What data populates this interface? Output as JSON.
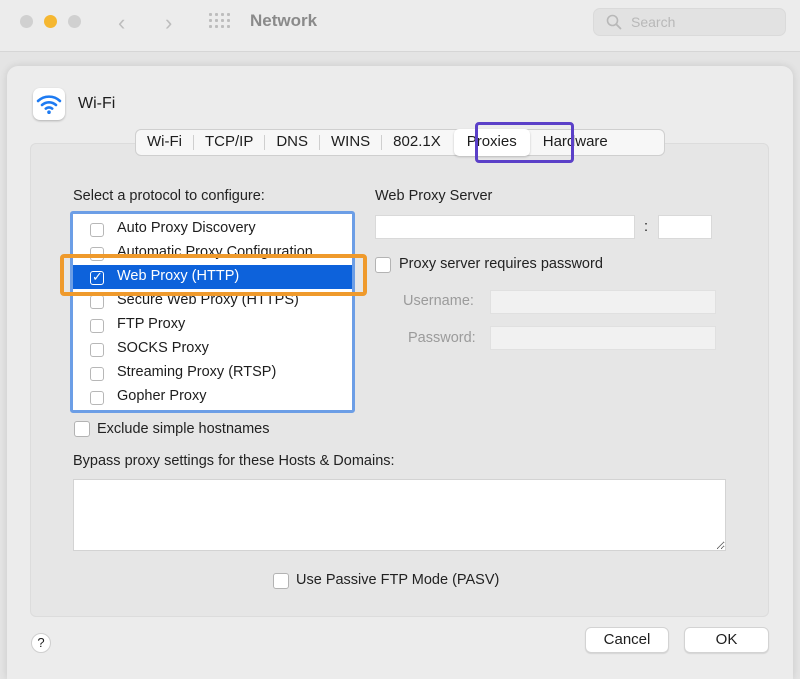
{
  "window": {
    "title": "Network",
    "search_placeholder": "Search",
    "colors": {
      "close": "#d0d0d0",
      "minimize": "#f5b731",
      "zoom": "#d0d0d0"
    }
  },
  "interface": {
    "name": "Wi-Fi",
    "icon": "wifi-icon"
  },
  "tabs": [
    {
      "label": "Wi-Fi",
      "active": false
    },
    {
      "label": "TCP/IP",
      "active": false
    },
    {
      "label": "DNS",
      "active": false
    },
    {
      "label": "WINS",
      "active": false
    },
    {
      "label": "802.1X",
      "active": false
    },
    {
      "label": "Proxies",
      "active": true
    },
    {
      "label": "Hardware",
      "active": false
    }
  ],
  "protocols": {
    "heading": "Select a protocol to configure:",
    "items": [
      {
        "label": "Auto Proxy Discovery",
        "checked": false,
        "selected": false
      },
      {
        "label": "Automatic Proxy Configuration",
        "checked": false,
        "selected": false
      },
      {
        "label": "Web Proxy (HTTP)",
        "checked": true,
        "selected": true
      },
      {
        "label": "Secure Web Proxy (HTTPS)",
        "checked": false,
        "selected": false
      },
      {
        "label": "FTP Proxy",
        "checked": false,
        "selected": false
      },
      {
        "label": "SOCKS Proxy",
        "checked": false,
        "selected": false
      },
      {
        "label": "Streaming Proxy (RTSP)",
        "checked": false,
        "selected": false
      },
      {
        "label": "Gopher Proxy",
        "checked": false,
        "selected": false
      }
    ]
  },
  "proxy_server": {
    "heading": "Web Proxy Server",
    "host_value": "",
    "separator": ":",
    "port_value": "",
    "requires_password_label": "Proxy server requires password",
    "requires_password": false,
    "username_label": "Username:",
    "username_value": "",
    "password_label": "Password:",
    "password_value": ""
  },
  "exclude_simple_hostnames": {
    "label": "Exclude simple hostnames",
    "checked": false
  },
  "bypass": {
    "label": "Bypass proxy settings for these Hosts & Domains:",
    "value": ""
  },
  "passive_ftp": {
    "label": "Use Passive FTP Mode (PASV)",
    "checked": false
  },
  "footer": {
    "help_label": "?",
    "cancel_label": "Cancel",
    "ok_label": "OK"
  },
  "annotations": {
    "tab_highlight_color": "#5b40c8",
    "row_highlight_color": "#ef9a2c",
    "list_border_color": "#6c9ee6"
  }
}
